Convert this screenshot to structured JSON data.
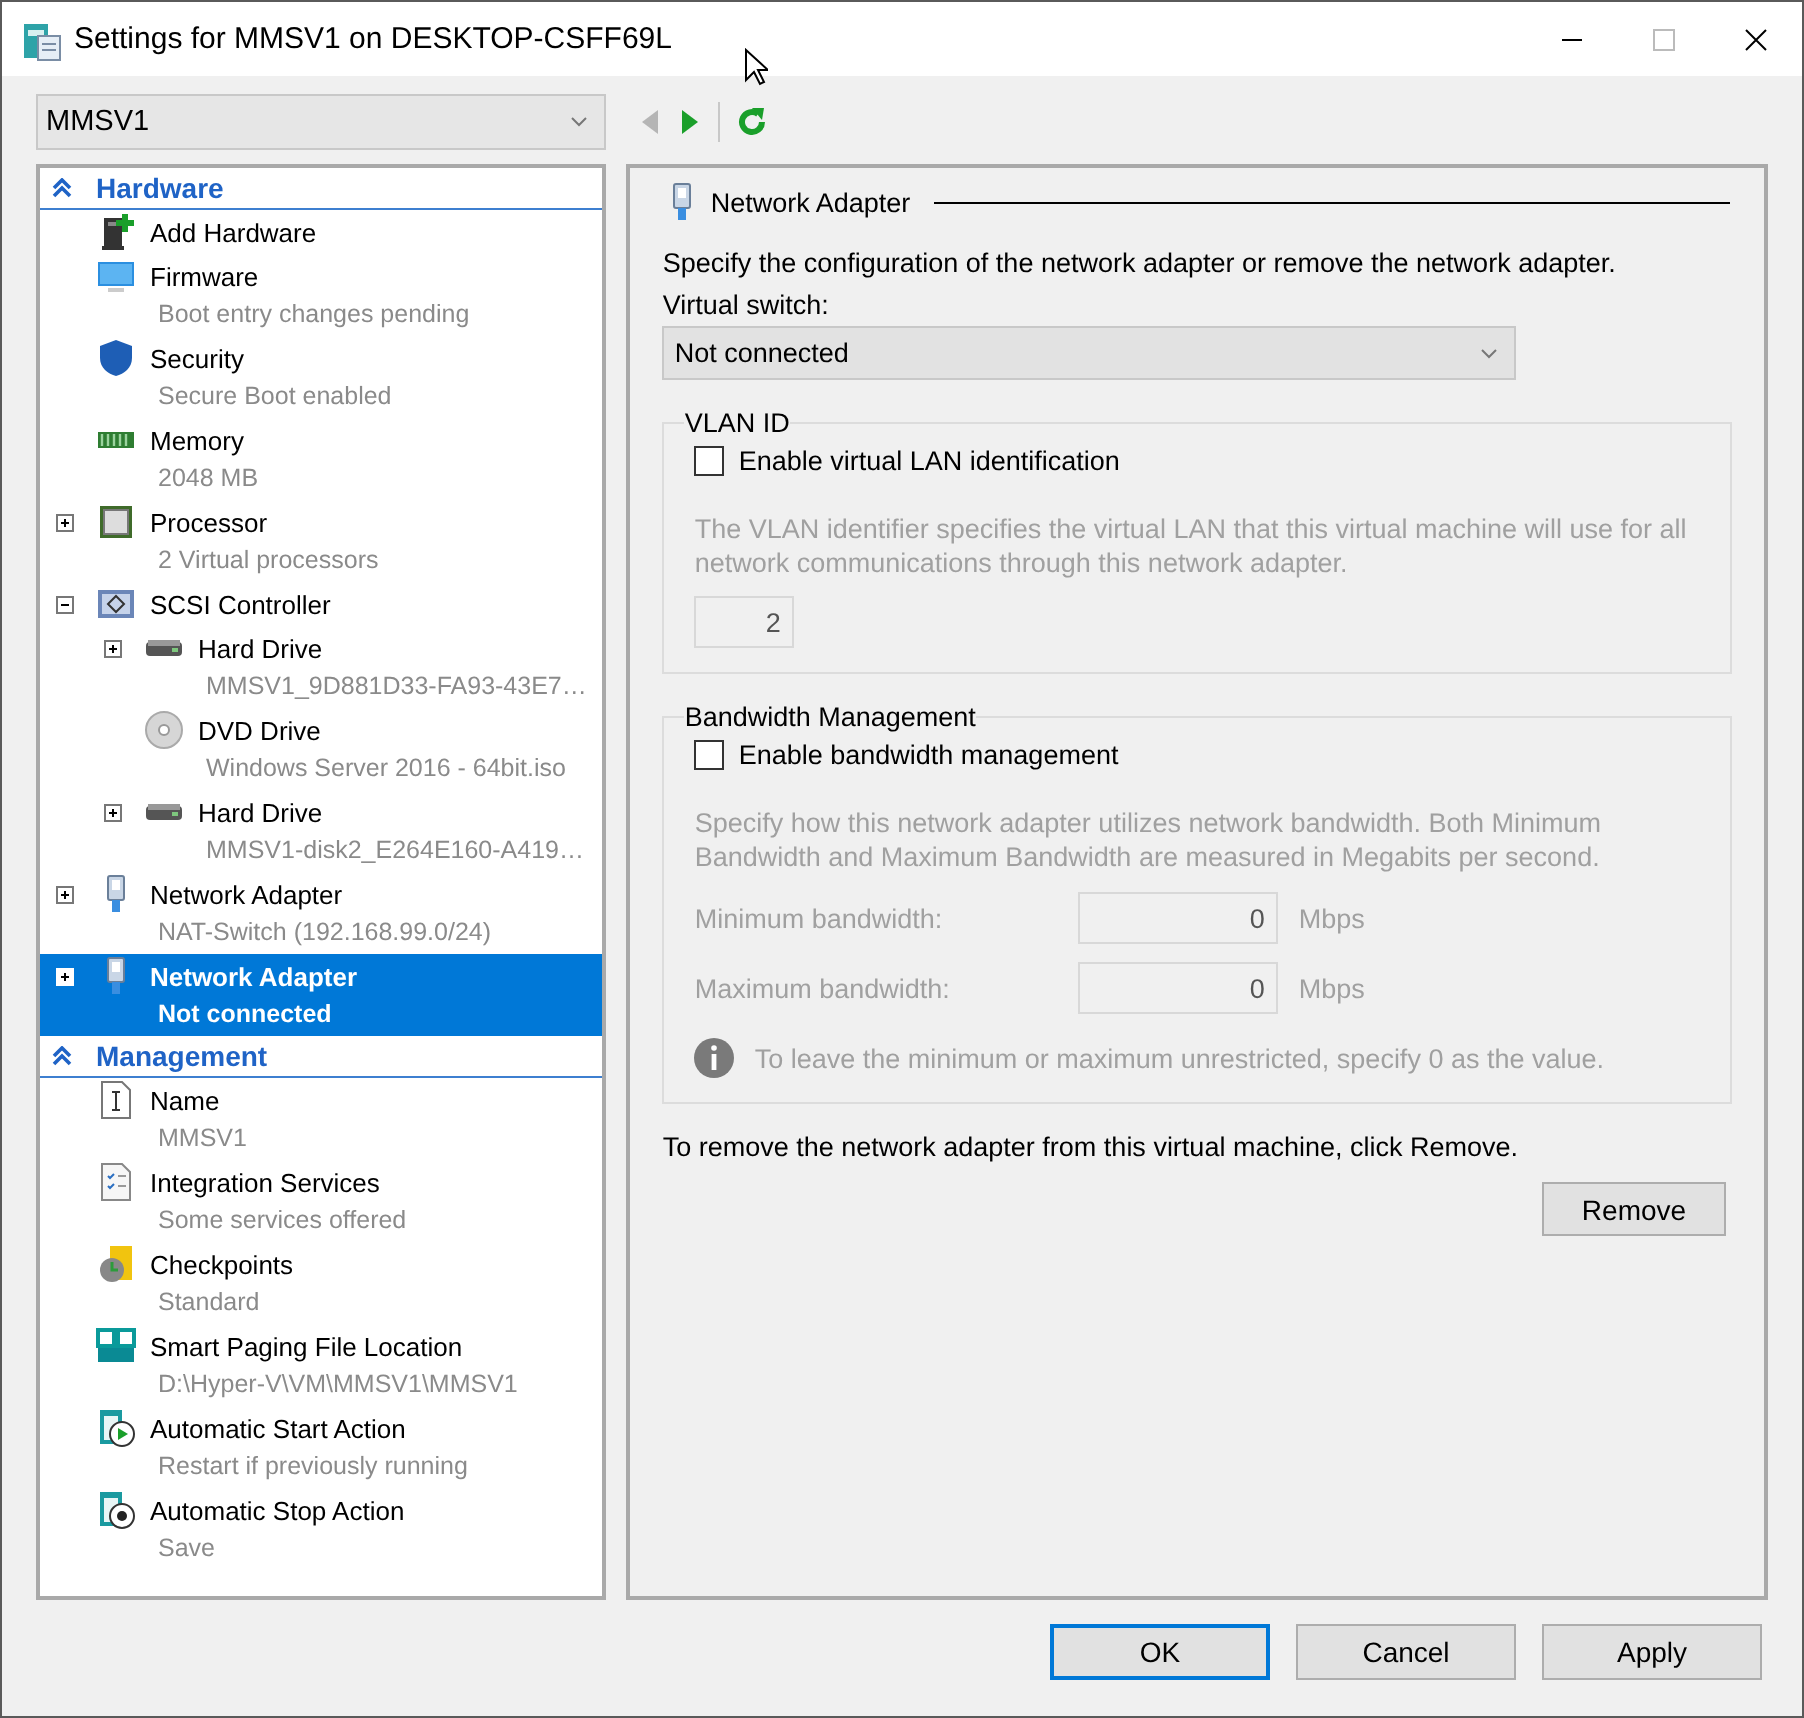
{
  "window": {
    "title": "Settings for MMSV1 on DESKTOP-CSFF69L"
  },
  "vm_selector": {
    "value": "MMSV1"
  },
  "toolbar": [
    {
      "kind": "back",
      "disabled": true
    },
    {
      "kind": "forward",
      "disabled": false
    },
    {
      "kind": "refresh",
      "disabled": false
    }
  ],
  "sidebar": {
    "sections": [
      {
        "title": "Hardware",
        "expanded": true,
        "items": [
          {
            "kind": "add-hardware",
            "label": "Add Hardware",
            "selected": false
          },
          {
            "kind": "firmware",
            "label": "Firmware",
            "detail": "Boot entry changes pending",
            "selected": false
          },
          {
            "kind": "security",
            "label": "Security",
            "detail": "Secure Boot enabled",
            "selected": false
          },
          {
            "kind": "memory",
            "label": "Memory",
            "detail": "2048 MB",
            "selected": false
          },
          {
            "kind": "processor",
            "label": "Processor",
            "detail": "2 Virtual processors",
            "expanded": false,
            "selected": false
          },
          {
            "kind": "controller",
            "label": "SCSI Controller",
            "expanded": true,
            "selected": false,
            "children": [
              {
                "kind": "hard-drive",
                "label": "Hard Drive",
                "detail": "MMSV1_9D881D33-FA93-43E7…",
                "expanded": false,
                "selected": false
              },
              {
                "kind": "dvd",
                "label": "DVD Drive",
                "detail": "Windows Server 2016 - 64bit.iso",
                "selected": false
              },
              {
                "kind": "hard-drive",
                "label": "Hard Drive",
                "detail": "MMSV1-disk2_E264E160-A419…",
                "expanded": false,
                "selected": false
              }
            ]
          },
          {
            "kind": "network",
            "label": "Network Adapter",
            "detail": "NAT-Switch (192.168.99.0/24)",
            "expanded": false,
            "selected": false
          },
          {
            "kind": "network",
            "label": "Network Adapter",
            "detail": "Not connected",
            "expanded": false,
            "selected": true
          }
        ]
      },
      {
        "title": "Management",
        "expanded": true,
        "items": [
          {
            "kind": "name",
            "label": "Name",
            "detail": "MMSV1",
            "selected": false
          },
          {
            "kind": "integration",
            "label": "Integration Services",
            "detail": "Some services offered",
            "selected": false
          },
          {
            "kind": "checkpoints",
            "label": "Checkpoints",
            "detail": "Standard",
            "selected": false
          },
          {
            "kind": "paging",
            "label": "Smart Paging File Location",
            "detail": "D:\\Hyper-V\\VM\\MMSV1\\MMSV1",
            "selected": false
          },
          {
            "kind": "start",
            "label": "Automatic Start Action",
            "detail": "Restart if previously running",
            "selected": false
          },
          {
            "kind": "stop",
            "label": "Automatic Stop Action",
            "detail": "Save",
            "selected": false
          }
        ]
      }
    ]
  },
  "panel": {
    "title": "Network Adapter",
    "description": "Specify the configuration of the network adapter or remove the network adapter.",
    "switch_label": "Virtual switch:",
    "switch_value": "Not connected",
    "groups": [
      {
        "title": "VLAN ID",
        "disabled": true,
        "checkbox": {
          "label": "Enable virtual LAN identification",
          "checked": false
        },
        "note": "The VLAN identifier specifies the virtual LAN that this virtual machine will use for all network communications through this network adapter.",
        "fields": [
          {
            "value": "2"
          }
        ]
      },
      {
        "title": "Bandwidth Management",
        "disabled": true,
        "checkbox": {
          "label": "Enable bandwidth management",
          "checked": false
        },
        "note": "Specify how this network adapter utilizes network bandwidth. Both Minimum Bandwidth and Maximum Bandwidth are measured in Megabits per second.",
        "fields": [
          {
            "label": "Minimum bandwidth:",
            "value": "0",
            "unit": "Mbps"
          },
          {
            "label": "Maximum bandwidth:",
            "value": "0",
            "unit": "Mbps"
          }
        ],
        "info": "To leave the minimum or maximum unrestricted, specify 0 as the value."
      }
    ],
    "remove_text": "To remove the network adapter from this virtual machine, click Remove.",
    "remove_button": "Remove"
  },
  "buttons": [
    {
      "label": "OK",
      "default": true
    },
    {
      "label": "Cancel",
      "default": false
    },
    {
      "label": "Apply",
      "default": false
    }
  ]
}
